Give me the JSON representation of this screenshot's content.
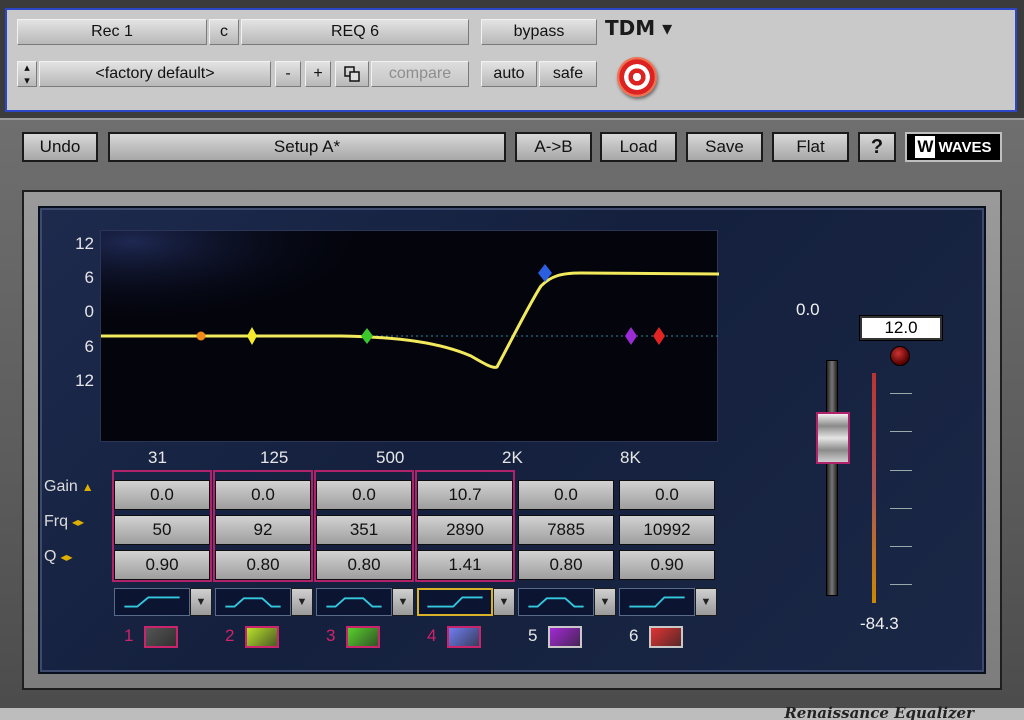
{
  "host": {
    "track": "Rec 1",
    "channel": "c",
    "insert": "REQ 6",
    "bypass": "bypass",
    "tdm": "TDM ▾",
    "preset": "<factory default>",
    "minus": "-",
    "plus": "+",
    "compare": "compare",
    "auto": "auto",
    "safe": "safe"
  },
  "toolbar": {
    "undo": "Undo",
    "setup": "Setup A*",
    "ab": "A->B",
    "load": "Load",
    "save": "Save",
    "flat": "Flat",
    "help": "?",
    "logo": "WAVES"
  },
  "graph": {
    "y_ticks": [
      "12",
      "6",
      "0",
      "6",
      "12"
    ],
    "x_ticks": [
      "31",
      "125",
      "500",
      "2K",
      "8K"
    ]
  },
  "rows": {
    "gain": "Gain",
    "frq": "Frq",
    "q": "Q"
  },
  "bands": [
    {
      "num": "1",
      "gain": "0.0",
      "frq": "50",
      "q": "0.90",
      "color": "#f28a1c",
      "swatch": "#555555",
      "numcolor": "#d0236c"
    },
    {
      "num": "2",
      "gain": "0.0",
      "frq": "92",
      "q": "0.80",
      "color": "#f2ea2b",
      "swatch": "#b7e22a",
      "numcolor": "#d0236c"
    },
    {
      "num": "3",
      "gain": "0.0",
      "frq": "351",
      "q": "0.80",
      "color": "#3cc82d",
      "swatch": "#57d12d",
      "numcolor": "#d0236c"
    },
    {
      "num": "4",
      "gain": "10.7",
      "frq": "2890",
      "q": "1.41",
      "color": "#2a5fe0",
      "swatch": "#6f7ef0",
      "numcolor": "#d0236c"
    },
    {
      "num": "5",
      "gain": "0.0",
      "frq": "7885",
      "q": "0.80",
      "color": "#9b2bd4",
      "swatch": "#a32ad6",
      "numcolor": "#e6e6e6"
    },
    {
      "num": "6",
      "gain": "0.0",
      "frq": "10992",
      "q": "0.90",
      "color": "#e02424",
      "swatch": "#e03434",
      "numcolor": "#e6e6e6"
    }
  ],
  "meter": {
    "gain": "0.0",
    "peak": "12.0",
    "level": "-84.3"
  },
  "footer": {
    "title": "Renaissance Equalizer"
  }
}
